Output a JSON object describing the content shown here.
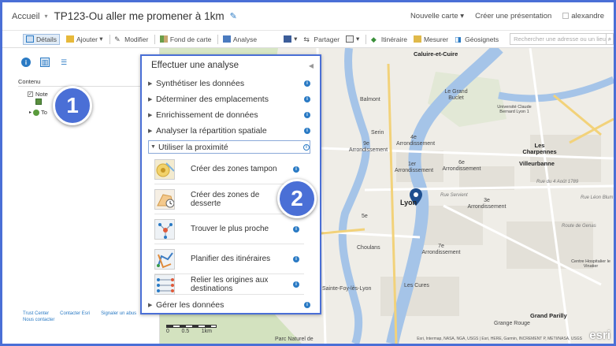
{
  "header": {
    "home_label": "Accueil",
    "map_title": "TP123-Ou aller me promener à 1km",
    "new_map": "Nouvelle carte",
    "create_presentation": "Créer une présentation",
    "user": "alexandre"
  },
  "toolbar": {
    "details": "Détails",
    "add": "Ajouter",
    "modify": "Modifier",
    "basemap": "Fond de carte",
    "analysis": "Analyse",
    "share": "Partager",
    "directions": "Itinéraire",
    "measure": "Mesurer",
    "bookmarks": "Géosignets",
    "search_placeholder": "Rechercher une adresse ou un lieu"
  },
  "contents": {
    "heading": "Contenu",
    "layer1": "Note",
    "layer3": "To"
  },
  "footer": {
    "trust": "Trust Center",
    "contact": "Contacter Esri",
    "report": "Signaler un abus",
    "new_contact": "Nous contacter"
  },
  "badges": {
    "one": "1",
    "two": "2"
  },
  "analysis": {
    "title": "Effectuer une analyse",
    "categories": [
      "Synthétiser les données",
      "Déterminer des emplacements",
      "Enrichissement de données",
      "Analyser la répartition spatiale",
      "Utiliser la proximité",
      "Gérer les données"
    ],
    "tools": [
      "Créer des zones tampon",
      "Créer des zones de desserte",
      "Trouver le plus proche",
      "Planifier des itinéraires",
      "Relier les origines aux destinations"
    ]
  },
  "map": {
    "labels": {
      "caluire": "Caluire-et-Cuire",
      "grand_buclet": "Le Grand Buclet",
      "balmont": "Balmont",
      "universite": "Université Claude Bernard Lyon 1",
      "serin": "Serin",
      "arr4": "4e Arrondissement",
      "arr9": "9e Arrondissement",
      "charpennes": "Les Charpennes",
      "arr1": "1er Arrondissement",
      "arr6": "6e Arrondissement",
      "villeurbanne": "Villeurbanne",
      "lyon": "Lyon",
      "arr3": "3e Arrondissement",
      "arr5": "5e",
      "choulans": "Choulans",
      "arr7": "7e Arrondissement",
      "sainte_foy": "Sainte-Foy-lès-Lyon",
      "cures": "Les Cures",
      "grand_parilly": "Grand Parilly",
      "grange_rouge": "Grange Rouge",
      "parc_naturel": "Parc Naturel de",
      "route_genas": "Route de Genas",
      "rue_leon_blum": "Rue Léon Blum",
      "rue_4_aout": "Rue du 4 Août 1789",
      "rue_servient": "Rue Servient",
      "hospitalier": "Centre Hospitalier le Vinatier"
    },
    "scale": "1km",
    "scale_left": "0",
    "scale_mid": "0.5",
    "attribution": "Esri, Intermap, NASA, NGA, USGS | Esri, HERE, Garmin, INCREMENT P, METI/NASA, USGS",
    "esri": "esri"
  },
  "colors": {
    "accent": "#4a6fd6",
    "link": "#2a7ac4",
    "river": "#a5c4e8",
    "park": "#cfe3b8"
  }
}
